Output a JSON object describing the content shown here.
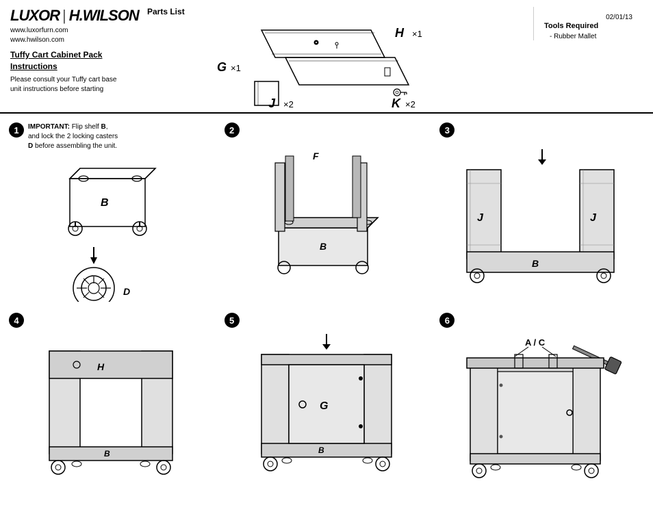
{
  "header": {
    "date": "02/01/13",
    "logo": {
      "luxor": "LUXOR",
      "divider": "|",
      "hwilson": "H.WILSON",
      "url1": "www.luxorfurn.com",
      "url2": "www.hwilson.com"
    },
    "product": {
      "title": "Tuffy Cart Cabinet Pack Instructions",
      "description": "Please consult your Tuffy cart base unit instructions before starting"
    },
    "parts_list": {
      "title": "Parts List",
      "items": [
        {
          "label": "G",
          "quantity": "x1"
        },
        {
          "label": "H",
          "quantity": "x1"
        },
        {
          "label": "J",
          "quantity": "x2"
        },
        {
          "label": "K",
          "quantity": "x2",
          "note": "Key"
        }
      ]
    },
    "tools": {
      "title": "Tools Required",
      "items": [
        "Rubber Mallet"
      ]
    }
  },
  "steps": [
    {
      "number": "1",
      "text_bold": "IMPORTANT:",
      "text": " Flip shelf B, and lock the 2 locking casters D before assembling the unit.",
      "labels": [
        "B",
        "D"
      ]
    },
    {
      "number": "2",
      "text": "",
      "labels": [
        "F",
        "B"
      ]
    },
    {
      "number": "3",
      "text": "",
      "labels": [
        "J",
        "J",
        "B"
      ]
    },
    {
      "number": "4",
      "text": "",
      "labels": [
        "H",
        "B"
      ]
    },
    {
      "number": "5",
      "text": "",
      "labels": [
        "G",
        "B"
      ]
    },
    {
      "number": "6",
      "text": "",
      "labels": [
        "A / C"
      ]
    }
  ]
}
